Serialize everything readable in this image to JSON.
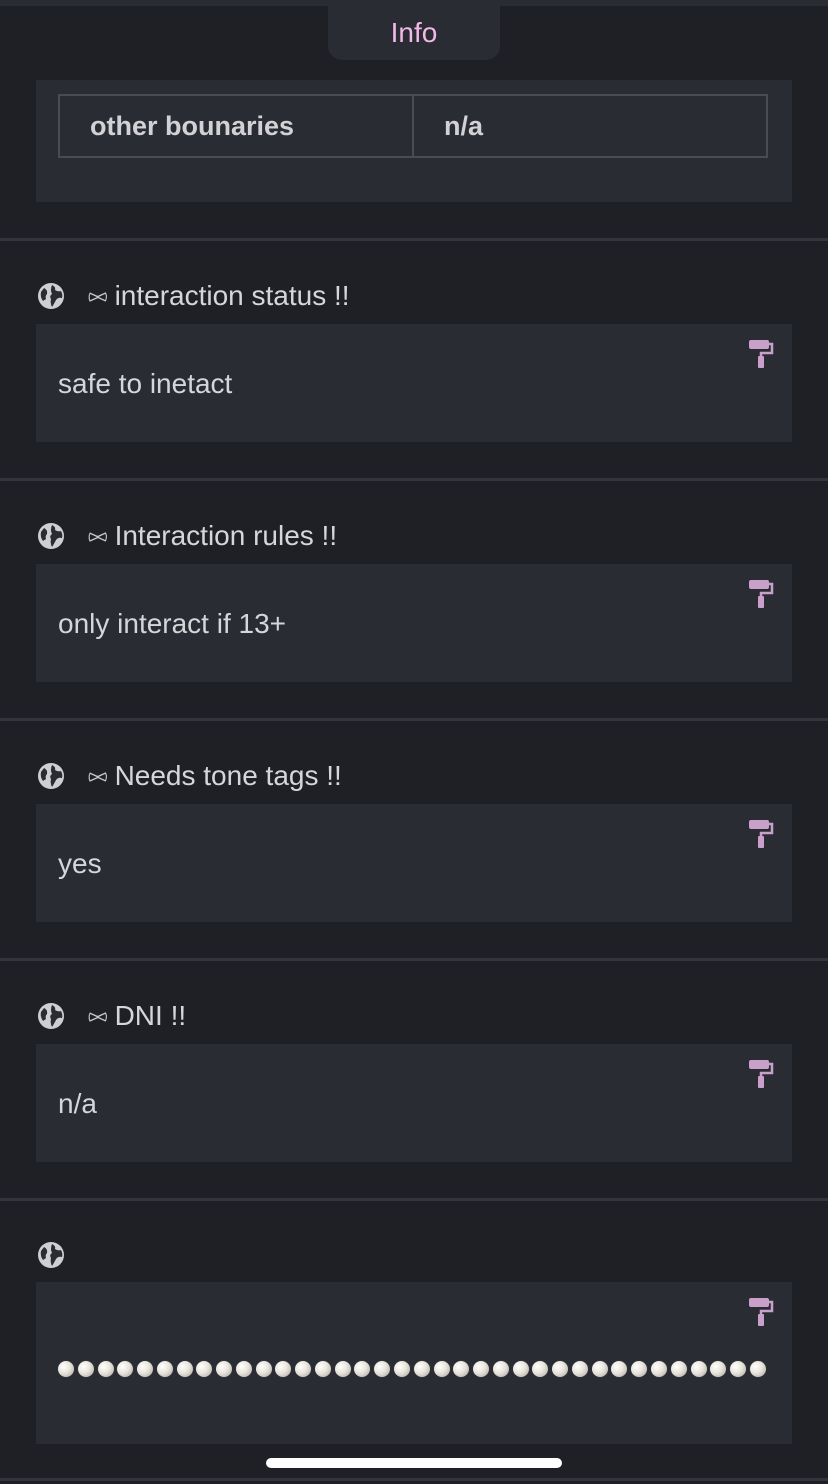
{
  "tab": {
    "label": "Info"
  },
  "table": {
    "key": "other bounaries",
    "value": "n/a"
  },
  "sections": [
    {
      "title": "interaction status !!",
      "value": "safe to inetact"
    },
    {
      "title": "Interaction rules !!",
      "value": "only interact if 13+"
    },
    {
      "title": "Needs tone tags !!",
      "value": "yes"
    },
    {
      "title": "DNI !!",
      "value": "n/a"
    }
  ],
  "bow_glyph": "⪧⪦",
  "pearl_count": 36,
  "colors": {
    "accent": "#f3b8e6",
    "icon": "#c9a0c9",
    "card": "#2a2c34",
    "bg": "#1f2026"
  }
}
